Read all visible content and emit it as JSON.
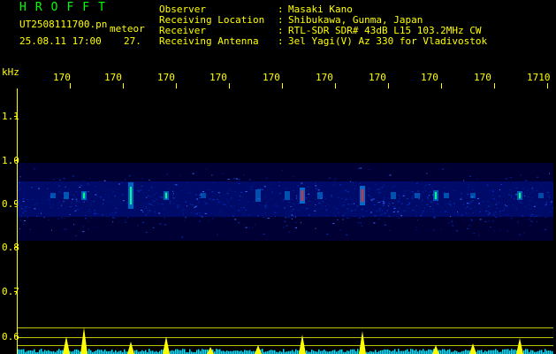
{
  "header": {
    "logo": "HROFFT",
    "filename": "UT2508111700.pn",
    "mode": "meteor",
    "datetime": "25.08.11 17:00",
    "count": "27.",
    "fields": [
      {
        "label": "Observer",
        "value": "Masaki Kano"
      },
      {
        "label": "Receiving Location",
        "value": "Shibukawa, Gunma, Japan"
      },
      {
        "label": "Receiver",
        "value": "RTL-SDR SDR# 43dB L15 103.2MHz CW"
      },
      {
        "label": "Receiving Antenna",
        "value": "3el Yagi(V) Az 330 for Vladivostok"
      }
    ],
    "colon": ":"
  },
  "axes": {
    "unit": "kHz",
    "y_ticks": [
      "1.1",
      "1.0",
      "0.9",
      "0.8",
      "0.7",
      "0.6"
    ],
    "x_ticks": [
      "170",
      "170",
      "170",
      "170",
      "170",
      "170",
      "170",
      "170",
      "170",
      "1710"
    ]
  },
  "colors": {
    "logo": "#00ff00",
    "text": "#ffff00",
    "axis": "#ffff00",
    "band": "#000080",
    "meteor": "#ff0000",
    "hist": "#ffff00",
    "hist_base": "#00ffff"
  }
}
